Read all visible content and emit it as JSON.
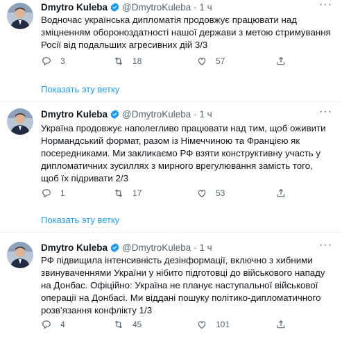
{
  "tweets": [
    {
      "author": "Dmytro Kuleba",
      "handle": "@DmytroKuleba",
      "separator": "·",
      "time": "1 ч",
      "text": "Водночас українська дипломатія продовжує працювати над зміцненням обороноздатності нашої держави з метою стримування Росії від подальших агресивних дій 3/3",
      "replies": "3",
      "retweets": "18",
      "likes": "57",
      "show_thread": "Показать эту ветку"
    },
    {
      "author": "Dmytro Kuleba",
      "handle": "@DmytroKuleba",
      "separator": "·",
      "time": "1 ч",
      "text": "Україна продовжує наполегливо працювати над тим, щоб оживити Нормандський формат, разом із Німеччиною та Францією як посередниками. Ми закликаємо РФ взяти конструктивну участь у дипломатичних зусиллях з мирного врегулювання замість того, щоб їх підривати 2/3",
      "replies": "1",
      "retweets": "17",
      "likes": "53",
      "show_thread": "Показать эту ветку"
    },
    {
      "author": "Dmytro Kuleba",
      "handle": "@DmytroKuleba",
      "separator": "·",
      "time": "1 ч",
      "text": "РФ підвищила інтенсивність дезінформації, включно з хибними звинуваченнями України у нібито підготовці до військового нападу на Донбас. Офіційно: Україна не планує наступальної військової операції на Донбасі. Ми віддані пошуку політико-дипломатичного розв’язання конфлікту 1/3",
      "replies": "4",
      "retweets": "45",
      "likes": "101",
      "show_thread": ""
    }
  ],
  "colors": {
    "accent": "#1d9bf0",
    "muted": "#536471",
    "text": "#0f1419",
    "divider": "#eff3f4"
  },
  "icons": {
    "reply": "speech-bubble-icon",
    "retweet": "retweet-arrows-icon",
    "like": "heart-icon",
    "share": "share-upload-icon",
    "verified": "verified-badge-icon",
    "more": "more-dots-icon"
  }
}
